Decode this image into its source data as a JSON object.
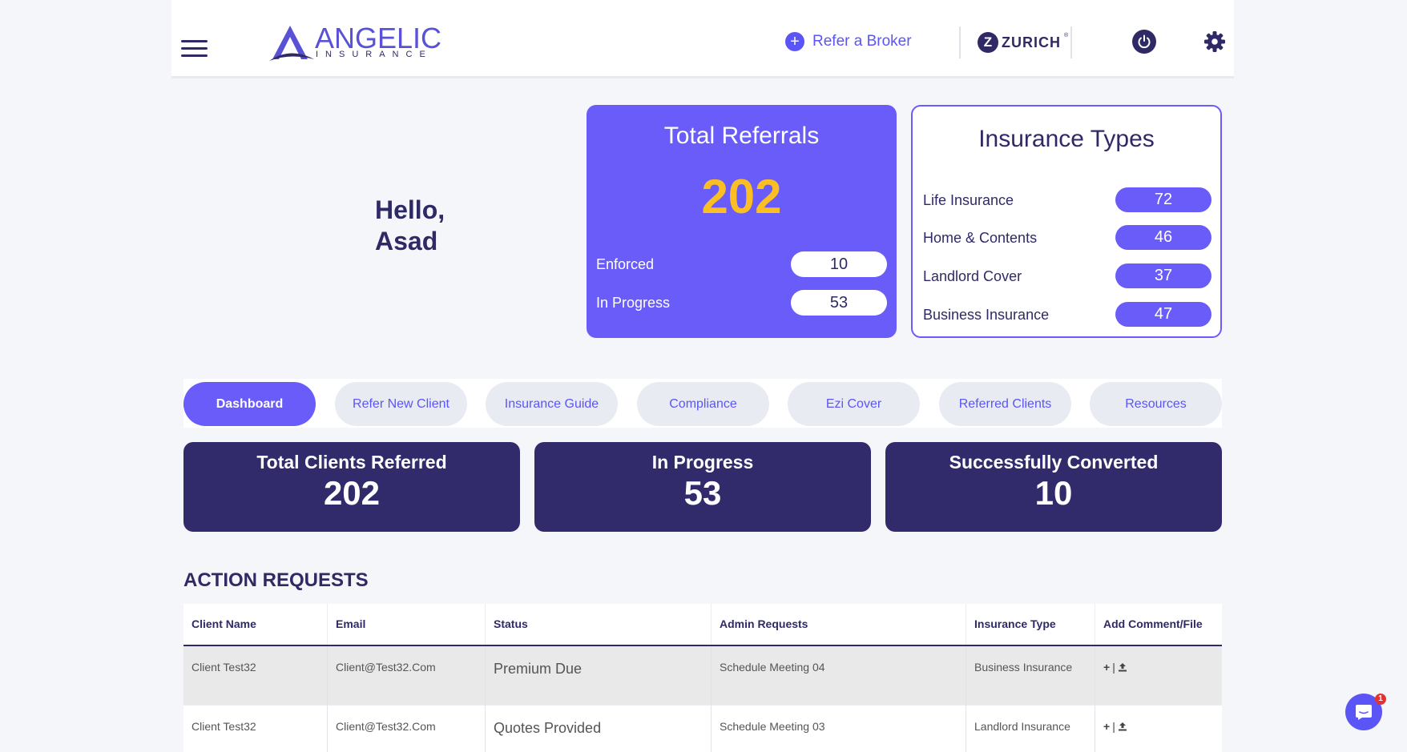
{
  "header": {
    "logo": {
      "word": "ANGELIC",
      "sub": "INSURANCE"
    },
    "refer_broker": "Refer a Broker",
    "partner": {
      "letter": "Z",
      "name": "ZURICH",
      "reg": "®"
    },
    "icons": {
      "menu": "hamburger-menu-icon",
      "power": "power-icon",
      "settings": "gear-icon",
      "add": "plus-circle-icon"
    }
  },
  "greeting": {
    "hello": "Hello,",
    "name": "Asad"
  },
  "total_referrals": {
    "title": "Total Referrals",
    "value": "202",
    "rows": [
      {
        "label": "Enforced",
        "value": "10"
      },
      {
        "label": "In Progress",
        "value": "53"
      }
    ]
  },
  "insurance_types": {
    "title": "Insurance Types",
    "rows": [
      {
        "label": "Life Insurance",
        "value": "72"
      },
      {
        "label": "Home & Contents",
        "value": "46"
      },
      {
        "label": "Landlord Cover",
        "value": "37"
      },
      {
        "label": "Business Insurance",
        "value": "47"
      }
    ]
  },
  "tabs": [
    {
      "label": "Dashboard",
      "active": true
    },
    {
      "label": "Refer New Client"
    },
    {
      "label": "Insurance Guide"
    },
    {
      "label": "Compliance"
    },
    {
      "label": "Ezi Cover"
    },
    {
      "label": "Referred Clients"
    },
    {
      "label": "Resources"
    }
  ],
  "stats": [
    {
      "label": "Total Clients Referred",
      "value": "202"
    },
    {
      "label": "In Progress",
      "value": "53"
    },
    {
      "label": "Successfully Converted",
      "value": "10"
    }
  ],
  "action_requests": {
    "title": "ACTION REQUESTS",
    "columns": [
      "Client Name",
      "Email",
      "Status",
      "Admin Requests",
      "Insurance Type",
      "Add Comment/File"
    ],
    "rows": [
      {
        "client": "Client Test32",
        "email": "Client@Test32.Com",
        "status": "Premium Due",
        "admin": "Schedule Meeting 04",
        "type": "Business Insurance"
      },
      {
        "client": "Client Test32",
        "email": "Client@Test32.Com",
        "status": "Quotes Provided",
        "admin": "Schedule Meeting 03",
        "type": "Landlord Insurance"
      }
    ],
    "action_icons": {
      "add": "+",
      "sep": "|",
      "upload": "upload-icon"
    }
  },
  "chat": {
    "badge": "1",
    "icon": "chat-icon"
  },
  "colors": {
    "accent": "#6a5cf8",
    "dark": "#312b6b",
    "highlight": "#fbbf24",
    "text": "#2f2a66"
  }
}
